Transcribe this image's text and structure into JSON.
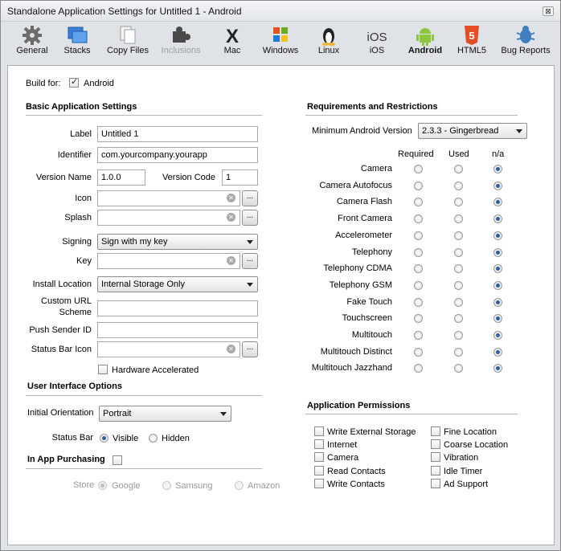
{
  "window": {
    "title": "Standalone Application Settings for Untitled 1 - Android",
    "close_label": "⊠"
  },
  "toolbar": [
    {
      "name": "general",
      "label": "General"
    },
    {
      "name": "stacks",
      "label": "Stacks"
    },
    {
      "name": "copy-files",
      "label": "Copy Files"
    },
    {
      "name": "inclusions",
      "label": "Inclusions"
    },
    {
      "name": "mac",
      "label": "Mac"
    },
    {
      "name": "windows",
      "label": "Windows"
    },
    {
      "name": "linux",
      "label": "Linux"
    },
    {
      "name": "ios",
      "label": "iOS"
    },
    {
      "name": "android",
      "label": "Android"
    },
    {
      "name": "html5",
      "label": "HTML5"
    },
    {
      "name": "bug-reports",
      "label": "Bug Reports"
    }
  ],
  "build_for": {
    "label": "Build for:",
    "platform": "Android",
    "checked": true
  },
  "basic": {
    "title": "Basic Application Settings",
    "label_label": "Label",
    "label_value": "Untitled 1",
    "identifier_label": "Identifier",
    "identifier_value": "com.yourcompany.yourapp",
    "version_name_label": "Version Name",
    "version_name_value": "1.0.0",
    "version_code_label": "Version Code",
    "version_code_value": "1",
    "icon_label": "Icon",
    "splash_label": "Splash",
    "signing_label": "Signing",
    "signing_value": "Sign with my key",
    "key_label": "Key",
    "install_label": "Install Location",
    "install_value": "Internal Storage Only",
    "custom_url_label_1": "Custom URL",
    "custom_url_label_2": "Scheme",
    "push_label": "Push Sender ID",
    "status_icon_label": "Status Bar Icon",
    "hw_accel_label": "Hardware Accelerated",
    "browse_label": "...",
    "clear_glyph": "✕"
  },
  "ui_options": {
    "title": "User Interface Options",
    "orientation_label": "Initial Orientation",
    "orientation_value": "Portrait",
    "status_bar_label": "Status Bar",
    "visible_label": "Visible",
    "hidden_label": "Hidden",
    "status_bar_value": "Visible"
  },
  "iap": {
    "title": "In App Purchasing",
    "checked": false,
    "store_label": "Store",
    "stores": [
      "Google",
      "Samsung",
      "Amazon"
    ],
    "selected": "Google"
  },
  "requirements": {
    "title": "Requirements and Restrictions",
    "min_version_label": "Minimum Android Version",
    "min_version_value": "2.3.3 - Gingerbread",
    "columns": [
      "Required",
      "Used",
      "n/a"
    ],
    "features": [
      "Camera",
      "Camera Autofocus",
      "Camera Flash",
      "Front Camera",
      "Accelerometer",
      "Telephony",
      "Telephony CDMA",
      "Telephony GSM",
      "Fake Touch",
      "Touchscreen",
      "Multitouch",
      "Multitouch Distinct",
      "Multitouch Jazzhand"
    ],
    "selected_column": "n/a"
  },
  "permissions": {
    "title": "Application Permissions",
    "left": [
      "Write External Storage",
      "Internet",
      "Camera",
      "Read Contacts",
      "Write Contacts"
    ],
    "right": [
      "Fine Location",
      "Coarse Location",
      "Vibration",
      "Idle Timer",
      "Ad Support"
    ]
  },
  "colors": {
    "accent": "#2a5fa8",
    "panel_bg": "#ffffff",
    "chrome_bg": "#dfe3e8"
  }
}
